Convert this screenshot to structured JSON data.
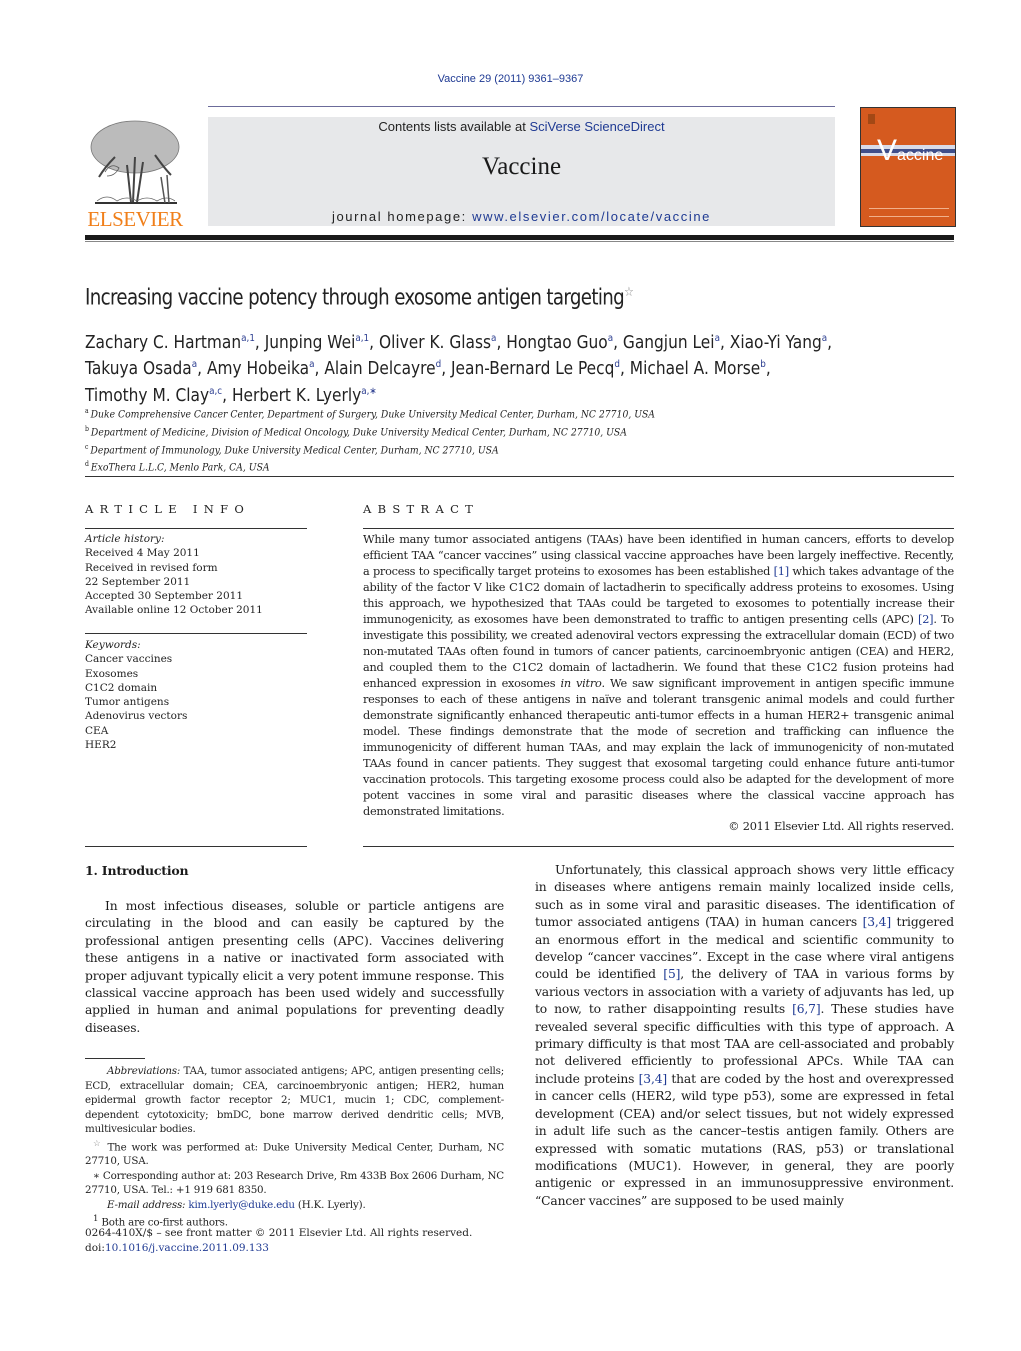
{
  "header": {
    "citation": "Vaccine 29 (2011) 9361–9367",
    "contents_prefix": "Contents lists available at ",
    "contents_link": "SciVerse ScienceDirect",
    "journal_title": "Vaccine",
    "homepage_prefix": "journal homepage: ",
    "homepage_link": "www.elsevier.com/locate/vaccine",
    "publisher_logo_text": "ELSEVIER",
    "cover_title_v": "V",
    "cover_title_rest": "accine",
    "colors": {
      "publisher_orange": "#f07f1a",
      "cover_orange": "#d55a1f",
      "link_blue": "#1f3a93",
      "banner_gray": "#e7e8ea"
    }
  },
  "article": {
    "title": "Increasing vaccine potency through exosome antigen targeting",
    "title_mark": "☆",
    "authors": [
      {
        "name": "Zachary C. Hartman",
        "sup": "a,1",
        "sep": ", "
      },
      {
        "name": "Junping Wei",
        "sup": "a,1",
        "sep": ", "
      },
      {
        "name": "Oliver K. Glass",
        "sup": "a",
        "sep": ", "
      },
      {
        "name": "Hongtao Guo",
        "sup": "a",
        "sep": ", "
      },
      {
        "name": "Gangjun Lei",
        "sup": "a",
        "sep": ", "
      },
      {
        "name": "Xiao-Yi Yang",
        "sup": "a",
        "sep": ", "
      },
      {
        "name": "Takuya Osada",
        "sup": "a",
        "sep": ", "
      },
      {
        "name": "Amy Hobeika",
        "sup": "a",
        "sep": ", "
      },
      {
        "name": "Alain Delcayre",
        "sup": "d",
        "sep": ", "
      },
      {
        "name": "Jean-Bernard Le Pecq",
        "sup": "d",
        "sep": ", "
      },
      {
        "name": "Michael A. Morse",
        "sup": "b",
        "sep": ", "
      },
      {
        "name": "Timothy M. Clay",
        "sup": "a,c",
        "sep": ", "
      },
      {
        "name": "Herbert K. Lyerly",
        "sup": "a,∗",
        "sep": ""
      }
    ],
    "affiliations": [
      {
        "key": "a",
        "text": "Duke Comprehensive Cancer Center, Department of Surgery, Duke University Medical Center, Durham, NC 27710, USA"
      },
      {
        "key": "b",
        "text": "Department of Medicine, Division of Medical Oncology, Duke University Medical Center, Durham, NC 27710, USA"
      },
      {
        "key": "c",
        "text": "Department of Immunology, Duke University Medical Center, Durham, NC 27710, USA"
      },
      {
        "key": "d",
        "text": "ExoThera L.L.C, Menlo Park, CA, USA"
      }
    ]
  },
  "article_info": {
    "heading": "ARTICLE INFO",
    "history_label": "Article history:",
    "history": [
      "Received 4 May 2011",
      "Received in revised form",
      "22 September 2011",
      "Accepted 30 September 2011",
      "Available online 12 October 2011"
    ],
    "keywords_label": "Keywords:",
    "keywords": [
      "Cancer vaccines",
      "Exosomes",
      "C1C2 domain",
      "Tumor antigens",
      "Adenovirus vectors",
      "CEA",
      "HER2"
    ]
  },
  "abstract": {
    "heading": "ABSTRACT",
    "p1": "While many tumor associated antigens (TAAs) have been identified in human cancers, efforts to develop efficient TAA “cancer vaccines” using classical vaccine approaches have been largely ineffective. Recently, a process to specifically target proteins to exosomes has been established ",
    "ref1": "[1]",
    "p2": " which takes advantage of the ability of the factor V like C1C2 domain of lactadherin to specifically address proteins to exosomes. Using this approach, we hypothesized that TAAs could be targeted to exosomes to potentially increase their immunogenicity, as exosomes have been demonstrated to traffic to antigen presenting cells (APC) ",
    "ref2": "[2]",
    "p3": ". To investigate this possibility, we created adenoviral vectors expressing the extracellular domain (ECD) of two non-mutated TAAs often found in tumors of cancer patients, carcinoembryonic antigen (CEA) and HER2, and coupled them to the C1C2 domain of lactadherin. We found that these C1C2 fusion proteins had enhanced expression in exosomes ",
    "italic": "in vitro",
    "p4": ". We saw significant improvement in antigen specific immune responses to each of these antigens in naïve and tolerant transgenic animal models and could further demonstrate significantly enhanced therapeutic anti-tumor effects in a human HER2+ transgenic animal model. These findings demonstrate that the mode of secretion and trafficking can influence the immunogenicity of different human TAAs, and may explain the lack of immunogenicity of non-mutated TAAs found in cancer patients. They suggest that exosomal targeting could enhance future anti-tumor vaccination protocols. This targeting exosome process could also be adapted for the development of more potent vaccines in some viral and parasitic diseases where the classical vaccine approach has demonstrated limitations.",
    "copyright": "© 2011 Elsevier Ltd. All rights reserved."
  },
  "introduction": {
    "heading": "1.  Introduction",
    "para1": "In most infectious diseases, soluble or particle antigens are circulating in the blood and can easily be captured by the professional antigen presenting cells (APC). Vaccines delivering these antigens in a native or inactivated form associated with proper adjuvant typically elicit a very potent immune response. This classical vaccine approach has been used widely and successfully applied in human and animal populations for preventing deadly diseases.",
    "para2": {
      "t1": "Unfortunately, this classical approach shows very little efficacy in diseases where antigens remain mainly localized inside cells, such as in some viral and parasitic diseases. The identification of tumor associated antigens (TAA) in human cancers ",
      "r1": "[3,4]",
      "t2": " triggered an enormous effort in the medical and scientific community to develop “cancer vaccines”. Except in the case where viral antigens could be identified ",
      "r2": "[5]",
      "t3": ", the delivery of TAA in various forms by various vectors in association with a variety of adjuvants has led, up to now, to rather disappointing results ",
      "r3": "[6,7]",
      "t4": ". These studies have revealed several specific difficulties with this type of approach. A primary difficulty is that most TAA are cell-associated and probably not delivered efficiently to professional APCs. While TAA can include proteins ",
      "r4": "[3,4]",
      "t5": " that are coded by the host and overexpressed in cancer cells (HER2, wild type p53), some are expressed in fetal development (CEA) and/or select tissues, but not widely expressed in adult life such as the cancer–testis antigen family. Others are expressed with somatic mutations (RAS, p53) or translational modifications (MUC1). However, in general, they are poorly antigenic or expressed in an immunosuppressive environment. “Cancer vaccines” are supposed to be used mainly"
    }
  },
  "footnotes": {
    "abbrev_label": "Abbreviations:",
    "abbrev_text": "  TAA, tumor associated antigens; APC, antigen presenting cells; ECD, extracellular domain; CEA, carcinoembryonic antigen; HER2, human epidermal growth factor receptor 2; MUC1, mucin 1; CDC, complement-dependent cytotoxicity; bmDC, bone marrow derived dendritic cells; MVB, multivesicular bodies.",
    "star_mark": "☆",
    "star_text": " The work was performed at: Duke University Medical Center, Durham, NC 27710, USA.",
    "corr_mark": "∗",
    "corr_text": " Corresponding author at: 203 Research Drive, Rm 433B Box 2606 Durham, NC 27710, USA. Tel.: +1 919 681 8350.",
    "email_label": "E-mail address:",
    "email": "kim.lyerly@duke.edu",
    "email_suffix": " (H.K. Lyerly).",
    "cofirst_mark": "1",
    "cofirst_text": " Both are co-first authors."
  },
  "front_matter": {
    "issn_line": "0264-410X/$ – see front matter © 2011 Elsevier Ltd. All rights reserved.",
    "doi_prefix": "doi:",
    "doi": "10.1016/j.vaccine.2011.09.133"
  }
}
